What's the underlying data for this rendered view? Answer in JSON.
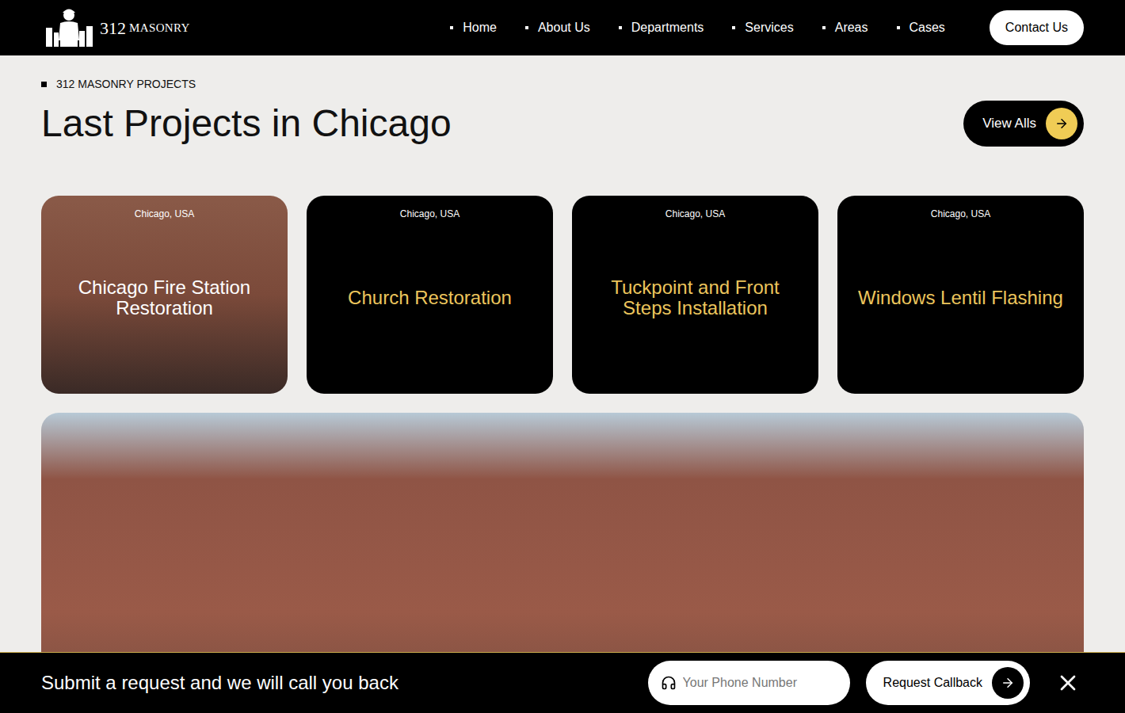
{
  "header": {
    "logo": {
      "number": "312",
      "name": "MASONRY"
    },
    "nav": [
      "Home",
      "About Us",
      "Departments",
      "Services",
      "Areas",
      "Cases"
    ],
    "contact_button": "Contact Us"
  },
  "section": {
    "eyebrow": "312 MASONRY PROJECTS",
    "title": "Last Projects in Chicago",
    "view_all": "View Alls"
  },
  "cards": [
    {
      "kind": "photo",
      "location": "Chicago, USA",
      "title": "Chicago Fire Station Restoration"
    },
    {
      "kind": "plain",
      "location": "Chicago, USA",
      "title": "Church Restoration"
    },
    {
      "kind": "plain",
      "location": "Chicago, USA",
      "title": "Tuckpoint and Front Steps Installation"
    },
    {
      "kind": "plain",
      "location": "Chicago, USA",
      "title": "Windows Lentil Flashing"
    }
  ],
  "callback_bar": {
    "text": "Submit a request and we will call you back",
    "phone_placeholder": "Your Phone Number",
    "button": "Request Callback"
  }
}
